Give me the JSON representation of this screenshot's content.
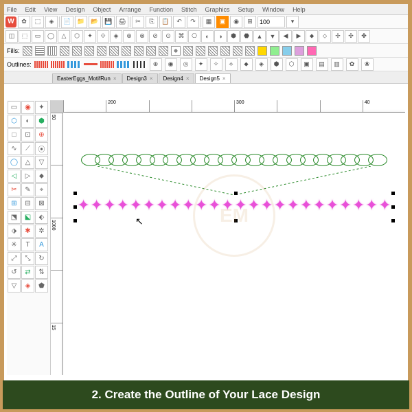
{
  "menu": {
    "items": [
      "File",
      "Edit",
      "View",
      "Design",
      "Object",
      "Arrange",
      "Function",
      "Stitch",
      "Graphics",
      "Setup",
      "Window",
      "Help"
    ]
  },
  "zoom": "100",
  "labels": {
    "fills": "Fills:",
    "outlines": "Outlines:"
  },
  "tabs": [
    {
      "label": "EasterEggs_MotifRun"
    },
    {
      "label": "Design3"
    },
    {
      "label": "Design4"
    },
    {
      "label": "Design5"
    }
  ],
  "ruler_h": [
    "",
    "200",
    "",
    "",
    "300",
    "",
    "",
    "40"
  ],
  "ruler_v": [
    "50",
    "",
    "1000",
    "",
    "15"
  ],
  "watermark_text": "EM",
  "caption": "2. Create the Outline of Your Lace Design"
}
